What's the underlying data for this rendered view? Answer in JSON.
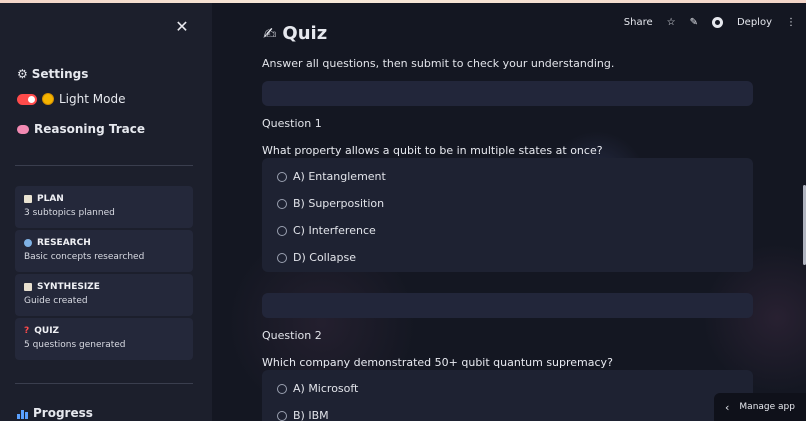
{
  "sidebar": {
    "close_icon": "close-icon",
    "settings": {
      "icon": "gear-icon",
      "label": "Settings"
    },
    "light_mode": {
      "icon": "sun-icon",
      "label": "Light Mode",
      "toggle_on": true,
      "toggle_color": "#ff4b4b"
    },
    "reasoning": {
      "icon": "brain-icon",
      "label": "Reasoning Trace"
    },
    "steps": [
      {
        "icon": "clipboard-icon",
        "title": "PLAN",
        "subtitle": "3 subtopics planned"
      },
      {
        "icon": "magnifier-icon",
        "title": "RESEARCH",
        "subtitle": "Basic concepts researched"
      },
      {
        "icon": "document-icon",
        "title": "SYNTHESIZE",
        "subtitle": "Guide created"
      },
      {
        "icon": "question-icon",
        "title": "QUIZ",
        "subtitle": "5 questions generated"
      }
    ],
    "progress": {
      "icon": "bar-chart-icon",
      "label": "Progress"
    }
  },
  "toolbar": {
    "share": "Share",
    "deploy": "Deploy"
  },
  "main": {
    "title_icon": "writing-hand-icon",
    "title": "Quiz",
    "intro": "Answer all questions, then submit to check your understanding.",
    "questions": [
      {
        "heading": "Question 1",
        "text": "What property allows a qubit to be in multiple states at once?",
        "options": [
          "A) Entanglement",
          "B) Superposition",
          "C) Interference",
          "D) Collapse"
        ]
      },
      {
        "heading": "Question 2",
        "text": "Which company demonstrated 50+ qubit quantum supremacy?",
        "options": [
          "A) Microsoft",
          "B) IBM"
        ]
      }
    ]
  },
  "manage_app": "Manage app",
  "colors": {
    "accent": "#ff4b4b",
    "background": "#141722",
    "sidebar": "#1c1f2c"
  }
}
